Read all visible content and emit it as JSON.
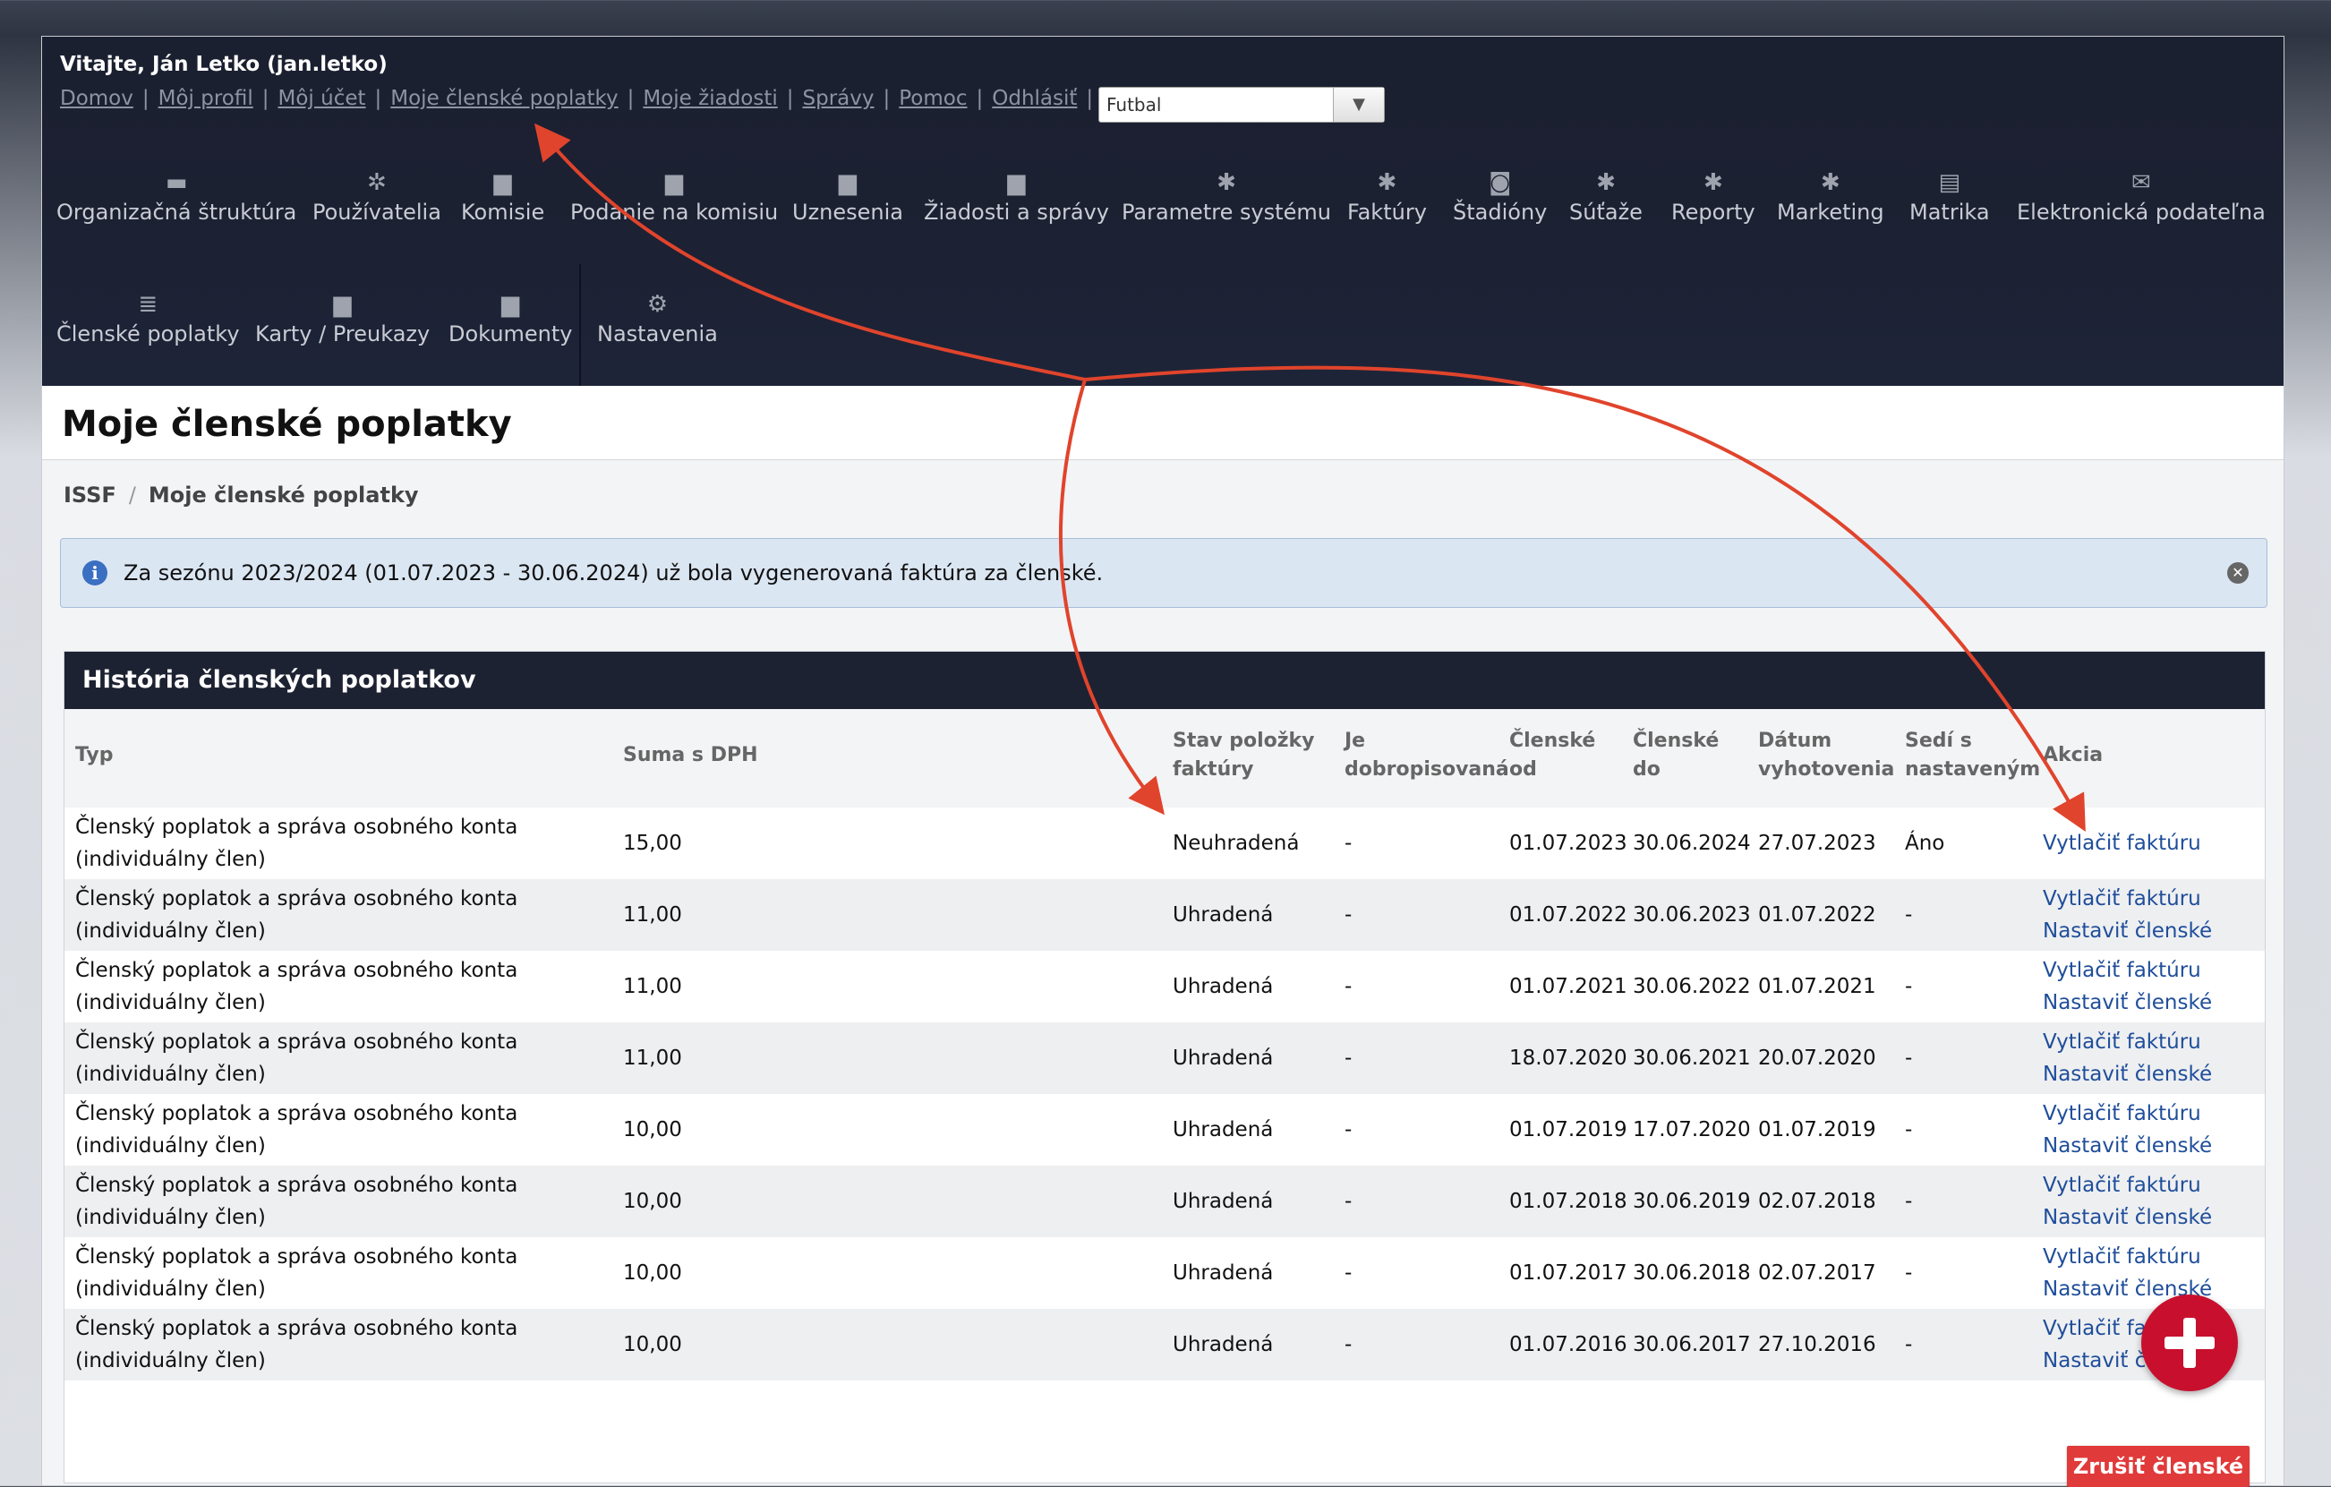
{
  "header": {
    "welcome": "Vitajte, Ján Letko (jan.letko)",
    "links": [
      "Domov",
      "Môj profil",
      "Môj účet",
      "Moje členské poplatky",
      "Moje žiadosti",
      "Správy",
      "Pomoc",
      "Odhlásiť"
    ],
    "sport_select": "Futbal"
  },
  "menu": {
    "row1": [
      "Organizačná štruktúra",
      "Používatelia",
      "Komisie",
      "Podanie na komisiu",
      "Uznesenia",
      "Žiadosti a správy",
      "Parametre systému",
      "Faktúry",
      "Štadióny",
      "Súťaže",
      "Reporty",
      "Marketing",
      "Matrika",
      "Elektronická podateľna"
    ],
    "row2": [
      "Členské poplatky",
      "Karty / Preukazy",
      "Dokumenty",
      "Nastavenia"
    ]
  },
  "page": {
    "title": "Moje členské poplatky",
    "breadcrumb": [
      "ISSF",
      "Moje členské poplatky"
    ]
  },
  "alert": {
    "message": "Za sezónu 2023/2024 (01.07.2023 - 30.06.2024) už bola vygenerovaná faktúra za členské."
  },
  "panel": {
    "title": "História členských poplatkov",
    "columns": {
      "typ": "Typ",
      "suma": "Suma s DPH",
      "stav1": "Stav položky",
      "stav2": "faktúry",
      "dobro1": "Je",
      "dobro2": "dobropisovaná",
      "od1": "Členské",
      "od2": "od",
      "do1": "Členské",
      "do2": "do",
      "datum1": "Dátum",
      "datum2": "vyhotovenia",
      "sedi1": "Sedí s",
      "sedi2": "nastaveným",
      "akcia": "Akcia"
    },
    "rows": [
      {
        "typ1": "Členský poplatok a správa osobného konta",
        "typ2": "(individuálny člen)",
        "suma": "15,00",
        "stav": "Neuhradená",
        "dobro": "-",
        "od": "01.07.2023",
        "do": "30.06.2024",
        "datum": "27.07.2023",
        "sedi": "Áno",
        "a1": "Vytlačiť faktúru",
        "a2": ""
      },
      {
        "typ1": "Členský poplatok a správa osobného konta",
        "typ2": "(individuálny člen)",
        "suma": "11,00",
        "stav": "Uhradená",
        "dobro": "-",
        "od": "01.07.2022",
        "do": "30.06.2023",
        "datum": "01.07.2022",
        "sedi": "-",
        "a1": "Vytlačiť faktúru",
        "a2": "Nastaviť členské"
      },
      {
        "typ1": "Členský poplatok a správa osobného konta",
        "typ2": "(individuálny člen)",
        "suma": "11,00",
        "stav": "Uhradená",
        "dobro": "-",
        "od": "01.07.2021",
        "do": "30.06.2022",
        "datum": "01.07.2021",
        "sedi": "-",
        "a1": "Vytlačiť faktúru",
        "a2": "Nastaviť členské"
      },
      {
        "typ1": "Členský poplatok a správa osobného konta",
        "typ2": "(individuálny člen)",
        "suma": "11,00",
        "stav": "Uhradená",
        "dobro": "-",
        "od": "18.07.2020",
        "do": "30.06.2021",
        "datum": "20.07.2020",
        "sedi": "-",
        "a1": "Vytlačiť faktúru",
        "a2": "Nastaviť členské"
      },
      {
        "typ1": "Členský poplatok a správa osobného konta",
        "typ2": "(individuálny člen)",
        "suma": "10,00",
        "stav": "Uhradená",
        "dobro": "-",
        "od": "01.07.2019",
        "do": "17.07.2020",
        "datum": "01.07.2019",
        "sedi": "-",
        "a1": "Vytlačiť faktúru",
        "a2": "Nastaviť členské"
      },
      {
        "typ1": "Členský poplatok a správa osobného konta",
        "typ2": "(individuálny člen)",
        "suma": "10,00",
        "stav": "Uhradená",
        "dobro": "-",
        "od": "01.07.2018",
        "do": "30.06.2019",
        "datum": "02.07.2018",
        "sedi": "-",
        "a1": "Vytlačiť faktúru",
        "a2": "Nastaviť členské"
      },
      {
        "typ1": "Členský poplatok a správa osobného konta",
        "typ2": "(individuálny člen)",
        "suma": "10,00",
        "stav": "Uhradená",
        "dobro": "-",
        "od": "01.07.2017",
        "do": "30.06.2018",
        "datum": "02.07.2017",
        "sedi": "-",
        "a1": "Vytlačiť faktúru",
        "a2": "Nastaviť členské"
      },
      {
        "typ1": "Členský poplatok a správa osobného konta",
        "typ2": "(individuálny člen)",
        "suma": "10,00",
        "stav": "Uhradená",
        "dobro": "-",
        "od": "01.07.2016",
        "do": "30.06.2017",
        "datum": "27.10.2016",
        "sedi": "-",
        "a1": "Vytlačiť faktúru",
        "a2": "Nastaviť členské"
      }
    ],
    "cancel_button": "Zrušiť členské"
  },
  "colors": {
    "header_bg": "#1c2133",
    "link": "#1f4e9a",
    "danger": "#e03a3a",
    "annotation_arrow": "#e0442c",
    "fab": "#c8102e"
  }
}
